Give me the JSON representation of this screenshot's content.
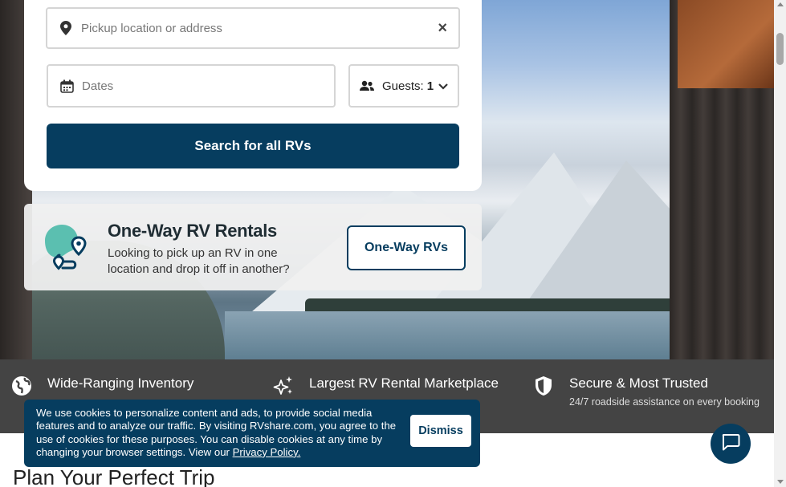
{
  "colors": {
    "brand": "#063d5f",
    "features_bg": "#444444",
    "accent_teal": "#5bbfb0"
  },
  "search": {
    "pickup_placeholder": "Pickup location or address",
    "dates_placeholder": "Dates",
    "guests_label": "Guests:",
    "guests_value": "1",
    "submit_label": "Search for all RVs",
    "icons": {
      "pickup": "map-pin-icon",
      "clear": "close-icon",
      "dates": "calendar-icon",
      "guests": "users-icon",
      "expand": "chevron-down-icon"
    }
  },
  "oneway": {
    "title": "One-Way RV Rentals",
    "description": "Looking to pick up an RV in one location and drop it off in another?",
    "button_label": "One-Way RVs",
    "icon": "route-map-icon"
  },
  "features": [
    {
      "title": "Wide-Ranging Inventory",
      "subtitle": "",
      "icon": "globe-icon"
    },
    {
      "title": "Largest RV Rental Marketplace",
      "subtitle": "",
      "icon": "sparkles-icon"
    },
    {
      "title": "Secure & Most Trusted",
      "subtitle": "24/7 roadside assistance on every booking",
      "icon": "shield-icon"
    }
  ],
  "cookie": {
    "message": "We use cookies to personalize content and ads, to provide social media features and to analyze our traffic. By visiting RVshare.com, you agree to the use of cookies for these purposes. You can disable cookies at any time by changing your browser settings. View our ",
    "link_label": "Privacy Policy.",
    "dismiss_label": "Dismiss"
  },
  "chat": {
    "icon": "chat-bubble-icon"
  },
  "section": {
    "title": "Plan Your Perfect Trip"
  }
}
